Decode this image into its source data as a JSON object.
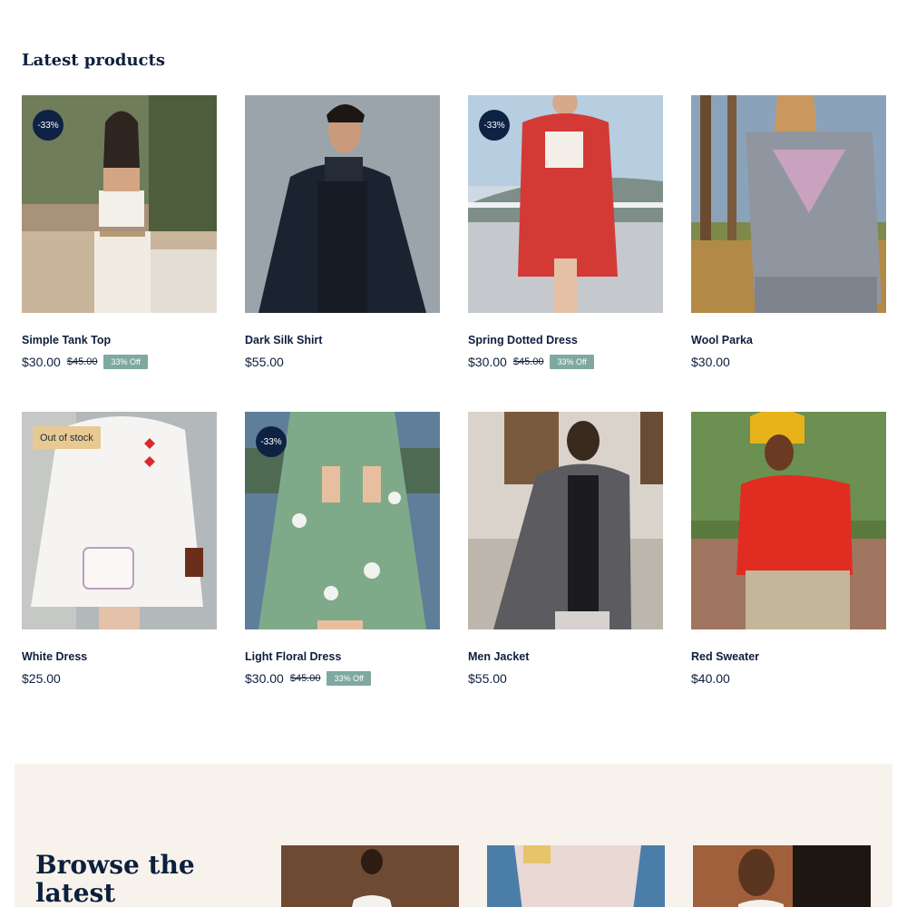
{
  "section_title": "Latest products",
  "products": [
    {
      "name": "Simple Tank Top",
      "price": "$30.00",
      "old_price": "$45.00",
      "off": "33% Off",
      "badge": "-33%"
    },
    {
      "name": "Dark Silk Shirt",
      "price": "$55.00"
    },
    {
      "name": "Spring Dotted Dress",
      "price": "$30.00",
      "old_price": "$45.00",
      "off": "33% Off",
      "badge": "-33%"
    },
    {
      "name": "Wool Parka",
      "price": "$30.00"
    },
    {
      "name": "White Dress",
      "price": "$25.00",
      "stock_badge": "Out of stock"
    },
    {
      "name": "Light Floral Dress",
      "price": "$30.00",
      "old_price": "$45.00",
      "off": "33% Off",
      "badge": "-33%"
    },
    {
      "name": "Men Jacket",
      "price": "$55.00"
    },
    {
      "name": "Red Sweater",
      "price": "$40.00"
    }
  ],
  "browse": {
    "title": "Browse the latest"
  },
  "colors": {
    "navy": "#0e2244",
    "off_tag": "#7fa9a0",
    "stock_tag": "#e8c992",
    "browse_bg": "#f7f3ec"
  }
}
